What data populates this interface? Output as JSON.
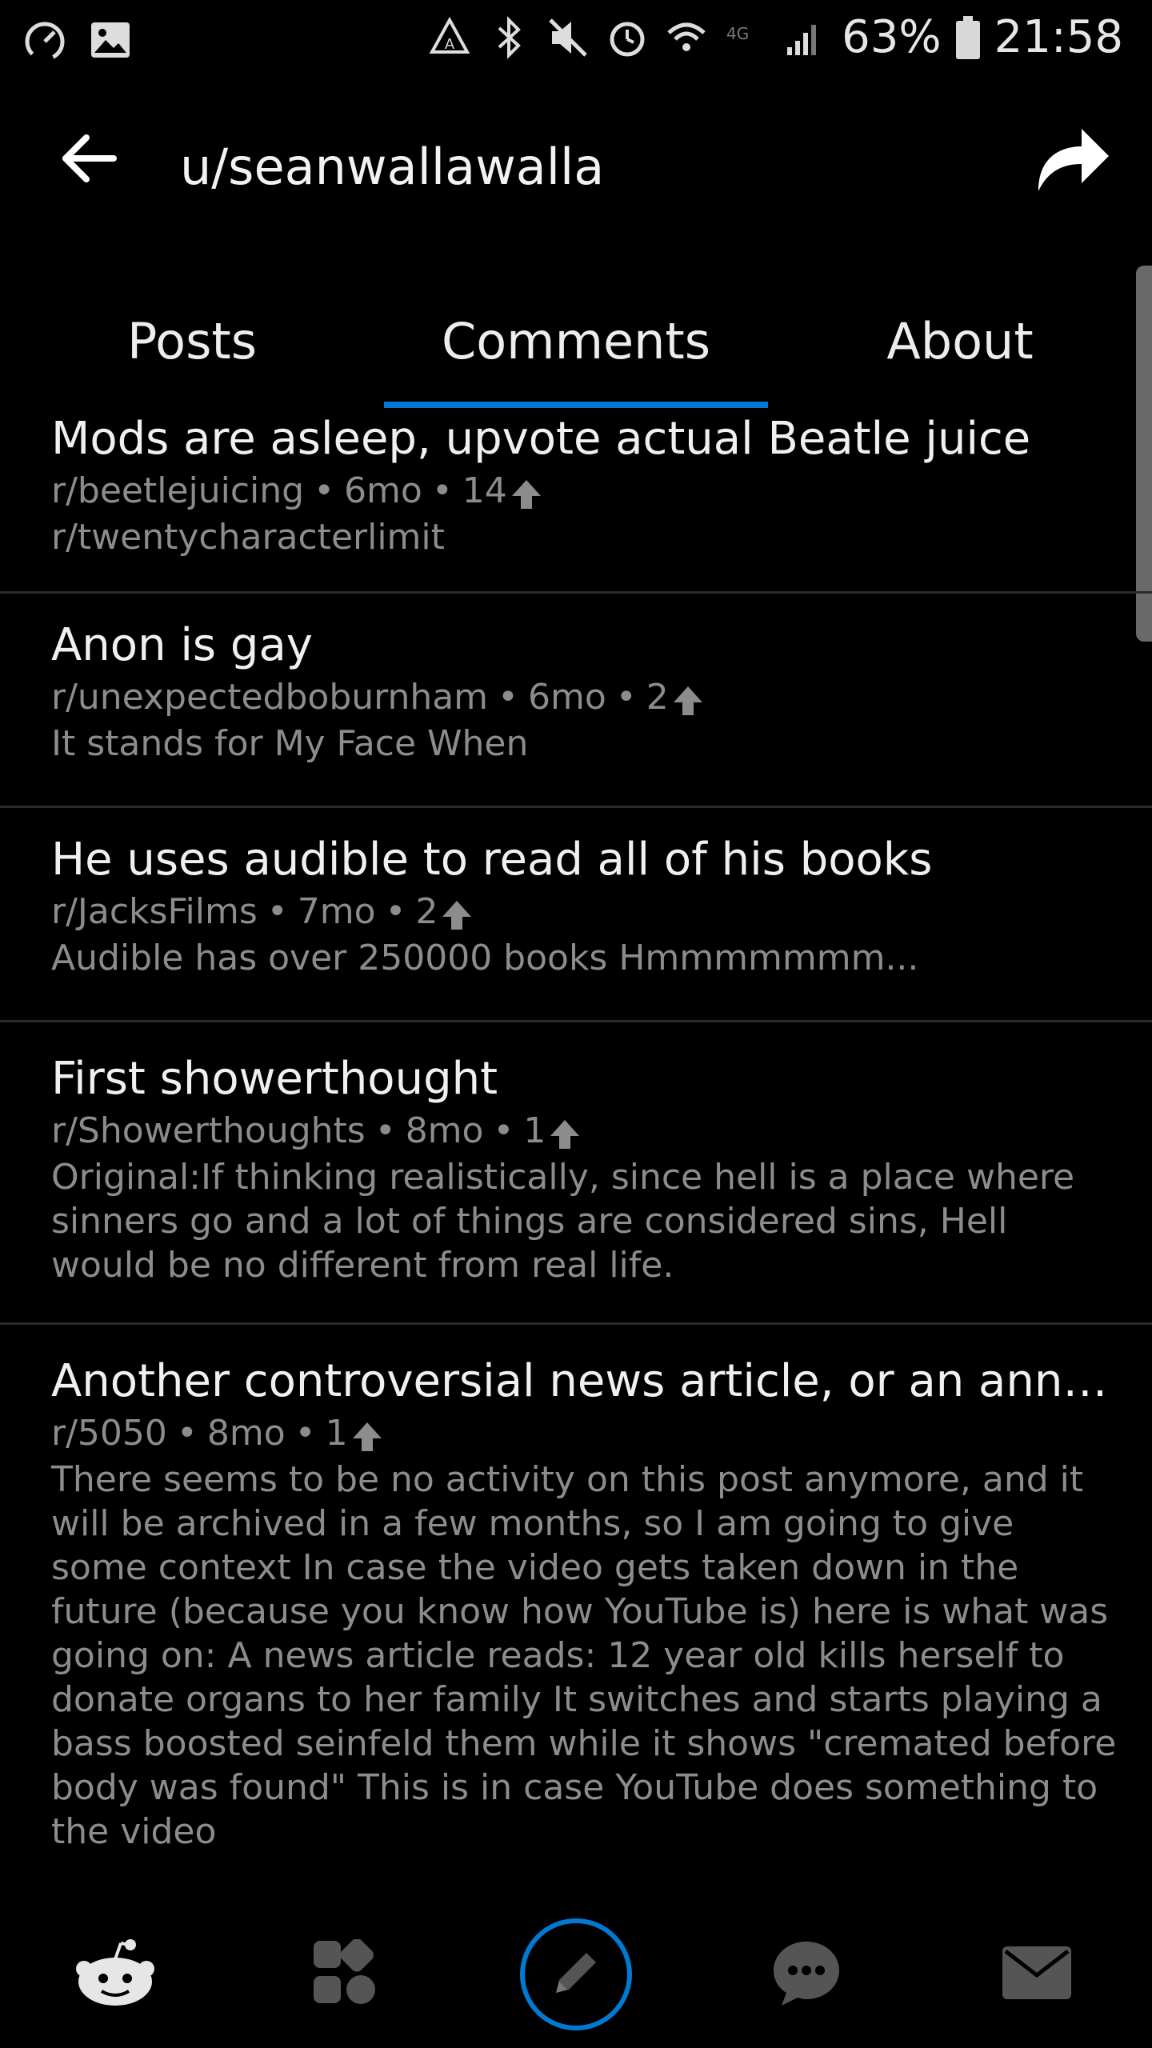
{
  "status_bar": {
    "battery_percent": "63%",
    "time": "21:58",
    "left_icons": [
      "speedometer-icon",
      "image-icon"
    ],
    "right_icons": [
      "recycle-icon",
      "bluetooth-icon",
      "mute-icon",
      "alarm-icon",
      "wifi-icon",
      "lte-icon",
      "signal-icon",
      "battery-icon"
    ]
  },
  "header": {
    "title": "u/seanwallawalla",
    "back_icon": "back-arrow-icon",
    "share_icon": "share-icon"
  },
  "tabs": [
    {
      "label": "Posts",
      "active": false
    },
    {
      "label": "Comments",
      "active": true
    },
    {
      "label": "About",
      "active": false
    }
  ],
  "accent_color": "#0079d3",
  "comments": [
    {
      "title": "Mods are asleep, upvote actual Beatle juice",
      "subreddit": "r/beetlejuicing",
      "age": "6mo",
      "score": "14",
      "body": "r/twentycharacterlimit"
    },
    {
      "title": "Anon is gay",
      "subreddit": "r/unexpectedboburnham",
      "age": "6mo",
      "score": "2",
      "body": "It stands for My Face When"
    },
    {
      "title": "He uses audible to read all of his books",
      "subreddit": "r/JacksFilms",
      "age": "7mo",
      "score": "2",
      "body": "Audible has over 250000 books Hmmmmmmm..."
    },
    {
      "title": "First showerthought",
      "subreddit": "r/Showerthoughts",
      "age": "8mo",
      "score": "1",
      "body": "Original:If thinking realistically, since hell is a place where sinners go and a lot of things are considered sins, Hell would be no different from real life."
    },
    {
      "title": "Another controversial news article, or an annoyi...",
      "subreddit": "r/5050",
      "age": "8mo",
      "score": "1",
      "body": "There seems to be no activity on this post anymore, and it will be archived in a few months, so I am going to give some context In case the video gets taken down in the future (because you know how YouTube is) here is what was going on: A news article reads: 12 year old kills herself to donate organs to her family It switches and starts playing a bass boosted seinfeld them while it shows \"cremated before body was found\" This is in case YouTube does something to the video"
    }
  ],
  "bottom_nav": [
    {
      "icon": "snoo-home-icon"
    },
    {
      "icon": "communities-grid-icon"
    },
    {
      "icon": "compose-pencil-icon"
    },
    {
      "icon": "chat-bubble-icon"
    },
    {
      "icon": "inbox-mail-icon"
    }
  ]
}
